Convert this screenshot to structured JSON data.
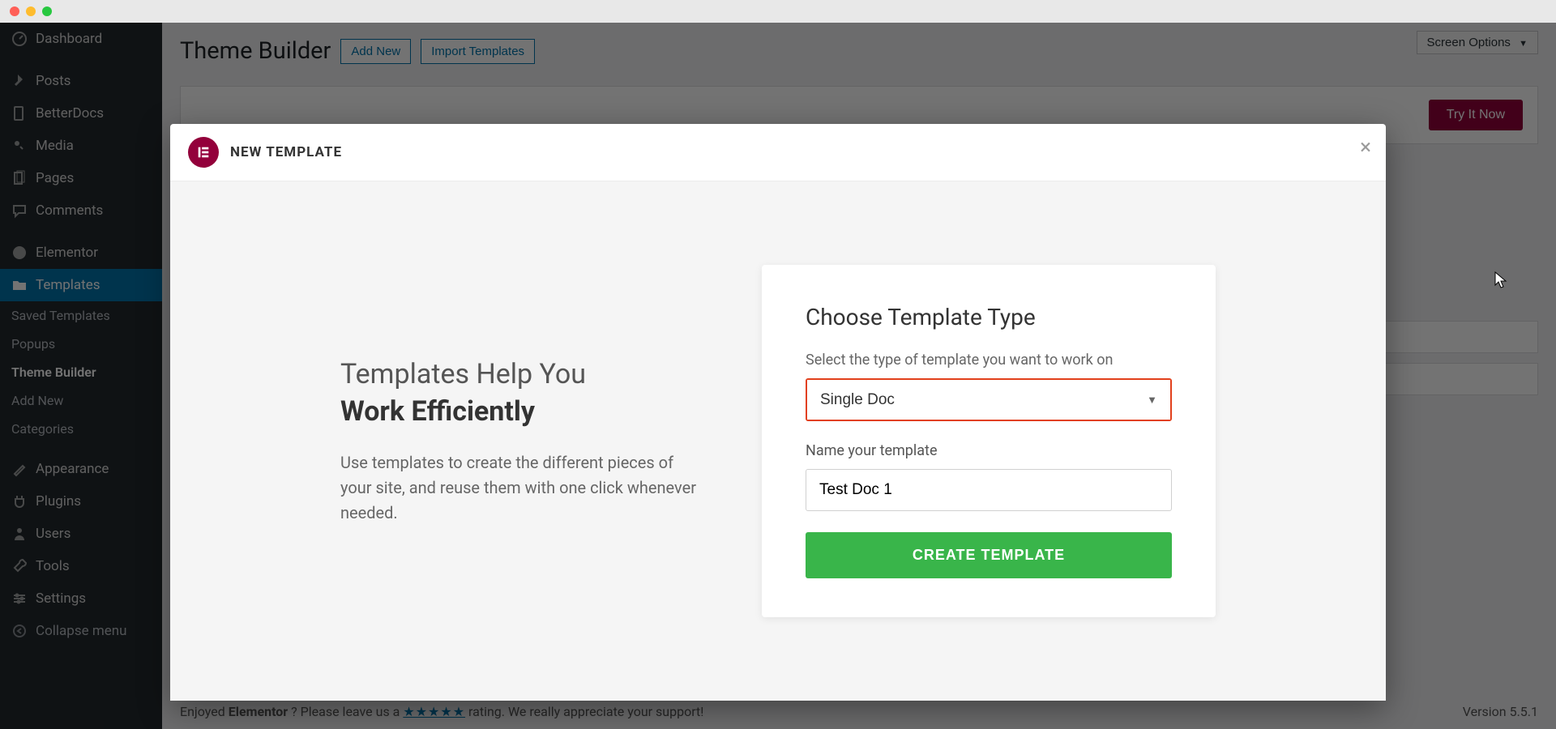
{
  "sidebar": {
    "items": [
      {
        "label": "Dashboard",
        "icon": "gauge"
      },
      {
        "label": "Posts",
        "icon": "pin"
      },
      {
        "label": "BetterDocs",
        "icon": "file"
      },
      {
        "label": "Media",
        "icon": "media"
      },
      {
        "label": "Pages",
        "icon": "page"
      },
      {
        "label": "Comments",
        "icon": "chat"
      },
      {
        "label": "Elementor",
        "icon": "elementor"
      },
      {
        "label": "Templates",
        "icon": "folder",
        "active": true
      },
      {
        "label": "Appearance",
        "icon": "brush"
      },
      {
        "label": "Plugins",
        "icon": "plug"
      },
      {
        "label": "Users",
        "icon": "user"
      },
      {
        "label": "Tools",
        "icon": "wrench"
      },
      {
        "label": "Settings",
        "icon": "sliders"
      }
    ],
    "subitems": [
      "Saved Templates",
      "Popups",
      "Theme Builder",
      "Add New",
      "Categories"
    ],
    "collapse": "Collapse menu"
  },
  "page": {
    "title": "Theme Builder",
    "add_new": "Add New",
    "import": "Import Templates",
    "screen_options": "Screen Options",
    "try_it": "Try It Now"
  },
  "footer": {
    "prefix": "Enjoyed ",
    "strong": "Elementor",
    "mid": "? Please leave us a ",
    "stars": "★★★★★",
    "suffix": " rating. We really appreciate your support!",
    "version": "Version 5.5.1"
  },
  "modal": {
    "title": "NEW TEMPLATE",
    "logo_text": "E",
    "left_h_line1": "Templates Help You",
    "left_h_line2": "Work Efficiently",
    "left_p": "Use templates to create the different pieces of your site, and reuse them with one click whenever needed.",
    "card_title": "Choose Template Type",
    "card_sub": "Select the type of template you want to work on",
    "select_value": "Single Doc",
    "name_label": "Name your template",
    "name_value": "Test Doc 1",
    "create": "CREATE TEMPLATE"
  }
}
